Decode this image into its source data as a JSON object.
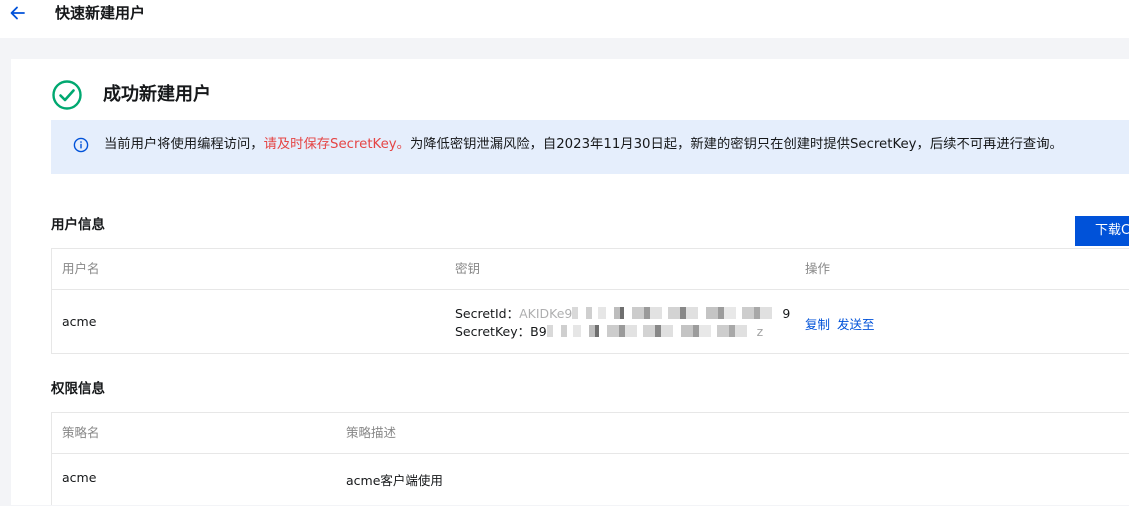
{
  "header": {
    "back_icon": "arrow-left-icon",
    "title": "快速新建用户"
  },
  "success": {
    "icon": "check-circle-icon",
    "title": "成功新建用户"
  },
  "notice": {
    "icon": "info-circle-icon",
    "text_before": "当前用户将使用编程访问，",
    "text_warn": "请及时保存SecretKey。",
    "text_after": "为降低密钥泄漏风险，自2023年11月30日起，新建的密钥只在创建时提供SecretKey，后续不可再进行查询。"
  },
  "user_info": {
    "section_title": "用户信息",
    "download_label": "下载CSV",
    "columns": {
      "username": "用户名",
      "key": "密钥",
      "actions": "操作"
    },
    "row": {
      "username": "acme",
      "secret_id_label": "SecretId：",
      "secret_id_start": "AKIDKe9",
      "secret_id_end": "9",
      "secret_key_label": "SecretKey：",
      "secret_key_start": "B9",
      "secret_key_end": "z",
      "copy_label": "复制",
      "send_label": "发送至"
    }
  },
  "permission_info": {
    "section_title": "权限信息",
    "columns": {
      "policy_name": "策略名",
      "policy_desc": "策略描述"
    },
    "row": {
      "policy_name": "acme",
      "policy_desc": "acme客户端使用"
    }
  },
  "colors": {
    "primary": "#0052d9",
    "success": "#00a870",
    "warning_text": "#e54545",
    "notice_bg": "#e5eefc"
  }
}
